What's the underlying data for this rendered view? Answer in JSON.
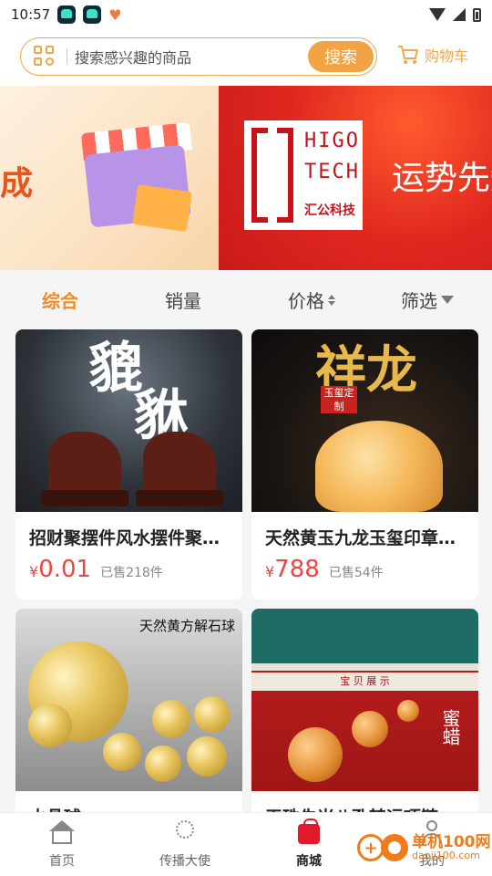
{
  "status_bar": {
    "time": "10:57"
  },
  "search": {
    "placeholder": "搜索感兴趣的商品",
    "button_label": "搜索"
  },
  "cart": {
    "label": "购物车"
  },
  "banner": {
    "left_text": "成",
    "logo_line1": "HIGO",
    "logo_line2": "TECH",
    "logo_cn": "汇公科技",
    "slogan": "运势先知"
  },
  "filters": [
    {
      "label": "综合",
      "active": true
    },
    {
      "label": "销量"
    },
    {
      "label": "价格",
      "icon": "sort-icon"
    },
    {
      "label": "筛选",
      "icon": "funnel-icon"
    }
  ],
  "products": [
    {
      "title": "招财聚摆件风水摆件聚宝盆",
      "currency": "¥",
      "price": "0.01",
      "sold": "已售218件",
      "image_text": [
        "貔",
        "貅"
      ]
    },
    {
      "title": "天然黄玉九龙玉玺印章摆件",
      "currency": "¥",
      "price": "788",
      "sold": "已售54件",
      "image_text": [
        "祥龙",
        "玉玺定制"
      ]
    },
    {
      "title": "水晶球",
      "image_text": [
        "天然黄方解石球"
      ]
    },
    {
      "title": "天珠朱米八孔转运项链",
      "image_text": [
        "蜜蜡",
        "宝 贝 展 示"
      ]
    }
  ],
  "bottom_nav": [
    {
      "label": "首页",
      "icon": "home-icon"
    },
    {
      "label": "传播大使",
      "icon": "dandelion-icon"
    },
    {
      "label": "商城",
      "icon": "shopping-bag-icon",
      "active": true
    },
    {
      "label": "我的",
      "icon": "person-icon"
    }
  ],
  "watermark": {
    "line1": "单机100网",
    "line2": "danji100.com"
  },
  "colors": {
    "accent": "#f2a445",
    "price": "#ee4444",
    "active_filter": "#f08c28",
    "nav_active": "#e11a2b"
  }
}
